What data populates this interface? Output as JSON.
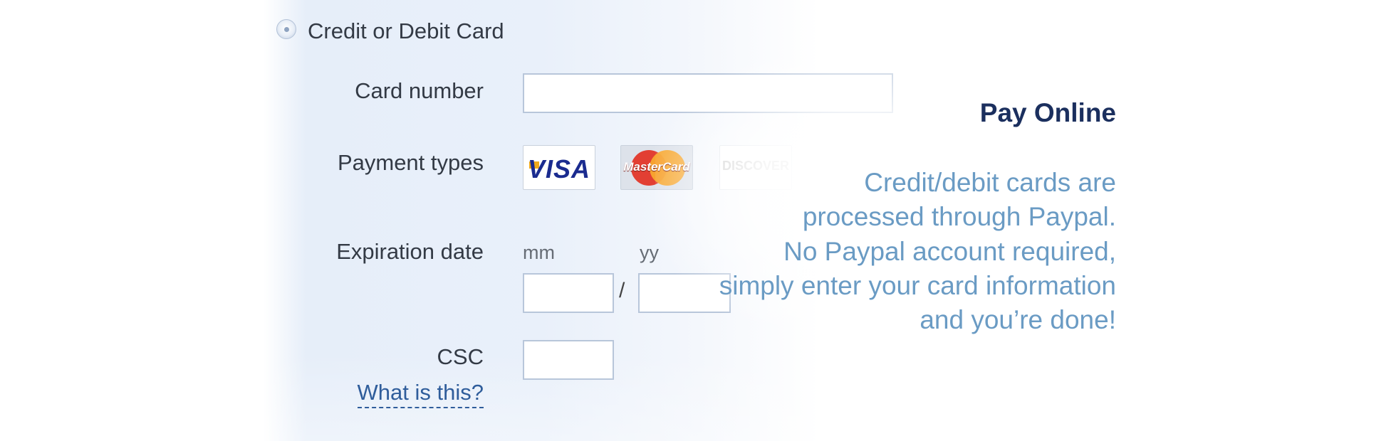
{
  "payment_option": {
    "label": "Credit or Debit Card"
  },
  "form": {
    "card_number_label": "Card number",
    "card_number_value": "",
    "payment_types_label": "Payment types",
    "payment_types": [
      "VISA",
      "MasterCard",
      "DISCOVER"
    ],
    "expiration_label": "Expiration date",
    "month_hint": "mm",
    "year_hint": "yy",
    "month_value": "",
    "year_value": "",
    "separator": "/",
    "csc_label": "CSC",
    "csc_value": "",
    "csc_help_link": "What is this?"
  },
  "promo": {
    "title": "Pay Online",
    "lines": [
      "Credit/debit cards are",
      "processed through Paypal.",
      "No Paypal account required,",
      "simply enter your card information",
      "and you’re done!"
    ]
  },
  "colors": {
    "promo_title": "#1b2f5e",
    "promo_text": "#6a9bc4",
    "link": "#2f5d9b",
    "form_background": "#e6eef9"
  }
}
